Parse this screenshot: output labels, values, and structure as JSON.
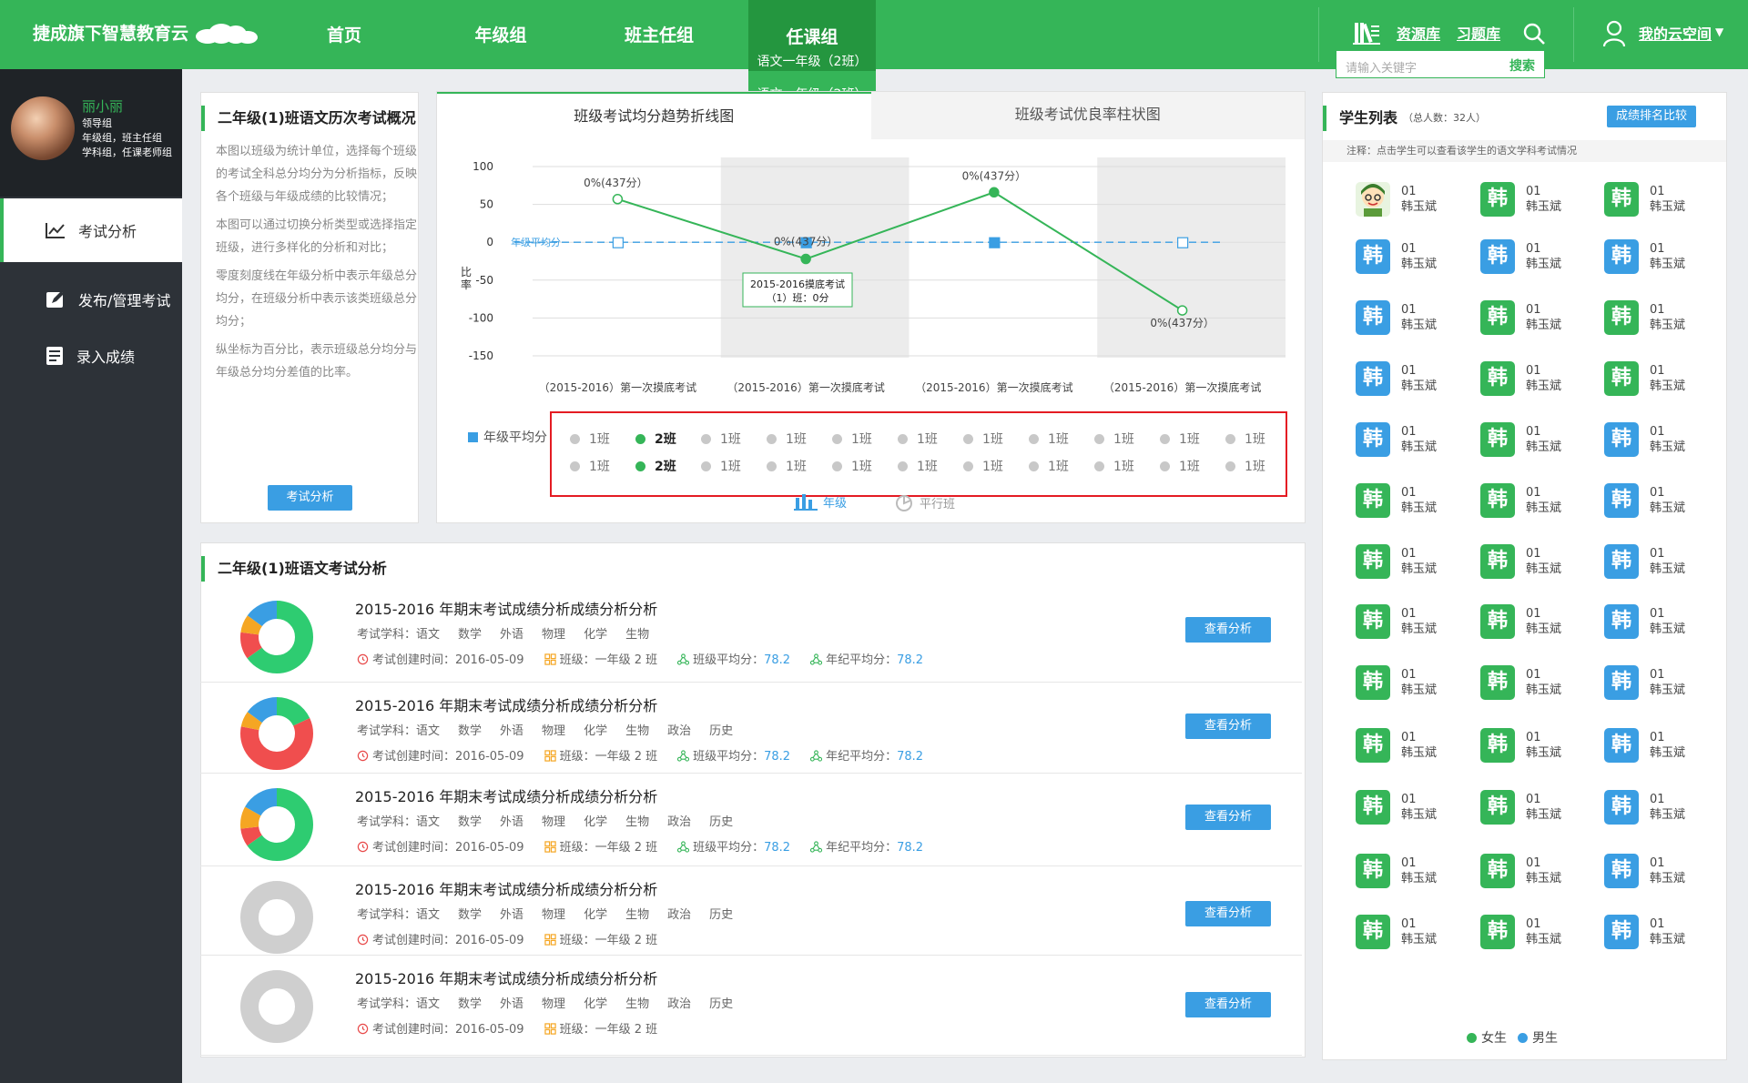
{
  "header": {
    "logo": "捷成旗下智慧教育云",
    "nav": [
      "首页",
      "年级组",
      "班主任组"
    ],
    "active_nav": {
      "title": "任课组",
      "sub": "语文一年级（2班）"
    },
    "dropdown": "语文一年级（2班）",
    "resource": "资源库",
    "exercise": "习题库",
    "cloud": "我的云空间",
    "search_placeholder": "请输入关键字",
    "search_button": "搜索"
  },
  "profile": {
    "name": "丽小丽",
    "line1": "领导组",
    "line2": "年级组，班主任组",
    "line3": "学科组，任课老师组"
  },
  "sidebar": [
    {
      "label": "考试分析"
    },
    {
      "label": "发布/管理考试"
    },
    {
      "label": "录入成绩"
    }
  ],
  "overview": {
    "title": "二年级(1)班语文历次考试概况",
    "p1": "本图以班级为统计单位，选择每个班级的考试全科总分均分为分析指标，反映各个班级与年级成绩的比较情况；",
    "p2": "本图可以通过切换分析类型或选择指定班级，进行多样化的分析和对比；",
    "p3": "零度刻度线在年级分析中表示年级总分均分，在班级分析中表示该类班级总分均分；",
    "p4": "纵坐标为百分比，表示班级总分均分与年级总分均分差值的比率。",
    "button": "考试分析"
  },
  "tabs": [
    "班级考试均分趋势折线图",
    "班级考试优良率柱状图"
  ],
  "chart_data": {
    "type": "line",
    "categories": [
      "（2015-2016）第一次摸底考试",
      "（2015-2016）第一次摸底考试",
      "（2015-2016）第一次摸底考试",
      "（2015-2016）第一次摸底考试"
    ],
    "series": [
      {
        "name": "年级平均分",
        "values": [
          0,
          0,
          0,
          0
        ]
      },
      {
        "name": "2班",
        "values": [
          57,
          -22,
          66,
          -90
        ]
      }
    ],
    "ylabel": "比率",
    "ylim": [
      -150,
      100
    ],
    "yticks": [
      100,
      50,
      0,
      -50,
      -100,
      -150
    ],
    "point_labels": [
      "0%(437分）",
      "0%(437分）",
      "0%(437分）",
      "0%(437分）"
    ],
    "tooltip_line1": "2015-2016摸底考试",
    "tooltip_line2": "（1）班：0分",
    "avg_label": "年级平均分",
    "legend_label": "年级平均分",
    "legend_rows": [
      [
        "1班",
        "2班",
        "1班",
        "1班",
        "1班",
        "1班",
        "1班",
        "1班",
        "1班",
        "1班",
        "1班"
      ],
      [
        "1班",
        "2班",
        "1班",
        "1班",
        "1班",
        "1班",
        "1班",
        "1班",
        "1班",
        "1班",
        "1班"
      ]
    ],
    "switch": [
      "年级",
      "平行班"
    ]
  },
  "students": {
    "title": "学生列表",
    "count": "（总人数：32人）",
    "compare_button": "成绩排名比较",
    "note": "注释：点击学生可以查看该学生的语文学科考试情况",
    "item_no": "01",
    "item_name": "韩玉斌",
    "avatar_char": "韩",
    "legend_female": "女生",
    "legend_male": "男生",
    "colors": {
      "female": "#35b558",
      "male": "#3a9ee3"
    }
  },
  "analysis": {
    "title": "二年级(1)班语文考试分析",
    "view_button": "查看分析",
    "exams": [
      {
        "title": "2015-2016 年期末考试成绩分析成绩分析分析",
        "subjects": [
          "考试学科：语文",
          "数学",
          "外语",
          "物理",
          "化学",
          "生物"
        ],
        "created": "考试创建时间：2016-05-09",
        "class": "班级：一年级 2 班",
        "class_avg_label": "班级平均分：",
        "class_avg": "78.2",
        "grade_avg_label": "年纪平均分：",
        "grade_avg": "78.2"
      },
      {
        "title": "2015-2016 年期末考试成绩分析成绩分析分析",
        "subjects": [
          "考试学科：语文",
          "数学",
          "外语",
          "物理",
          "化学",
          "生物",
          "政治",
          "历史"
        ],
        "created": "考试创建时间：2016-05-09",
        "class": "班级：一年级 2 班",
        "class_avg_label": "班级平均分：",
        "class_avg": "78.2",
        "grade_avg_label": "年纪平均分：",
        "grade_avg": "78.2"
      },
      {
        "title": "2015-2016 年期末考试成绩分析成绩分析分析",
        "subjects": [
          "考试学科：语文",
          "数学",
          "外语",
          "物理",
          "化学",
          "生物",
          "政治",
          "历史"
        ],
        "created": "考试创建时间：2016-05-09",
        "class": "班级：一年级 2 班",
        "class_avg_label": "班级平均分：",
        "class_avg": "78.2",
        "grade_avg_label": "年纪平均分：",
        "grade_avg": "78.2"
      },
      {
        "title": "2015-2016 年期末考试成绩分析成绩分析分析",
        "subjects": [
          "考试学科：语文",
          "数学",
          "外语",
          "物理",
          "化学",
          "生物",
          "政治",
          "历史"
        ],
        "created": "考试创建时间：2016-05-09",
        "class": "班级：一年级 2 班"
      },
      {
        "title": "2015-2016 年期末考试成绩分析成绩分析分析",
        "subjects": [
          "考试学科：语文",
          "数学",
          "外语",
          "物理",
          "化学",
          "生物",
          "政治",
          "历史"
        ],
        "created": "考试创建时间：2016-05-09",
        "class": "班级：一年级 2 班"
      }
    ]
  }
}
